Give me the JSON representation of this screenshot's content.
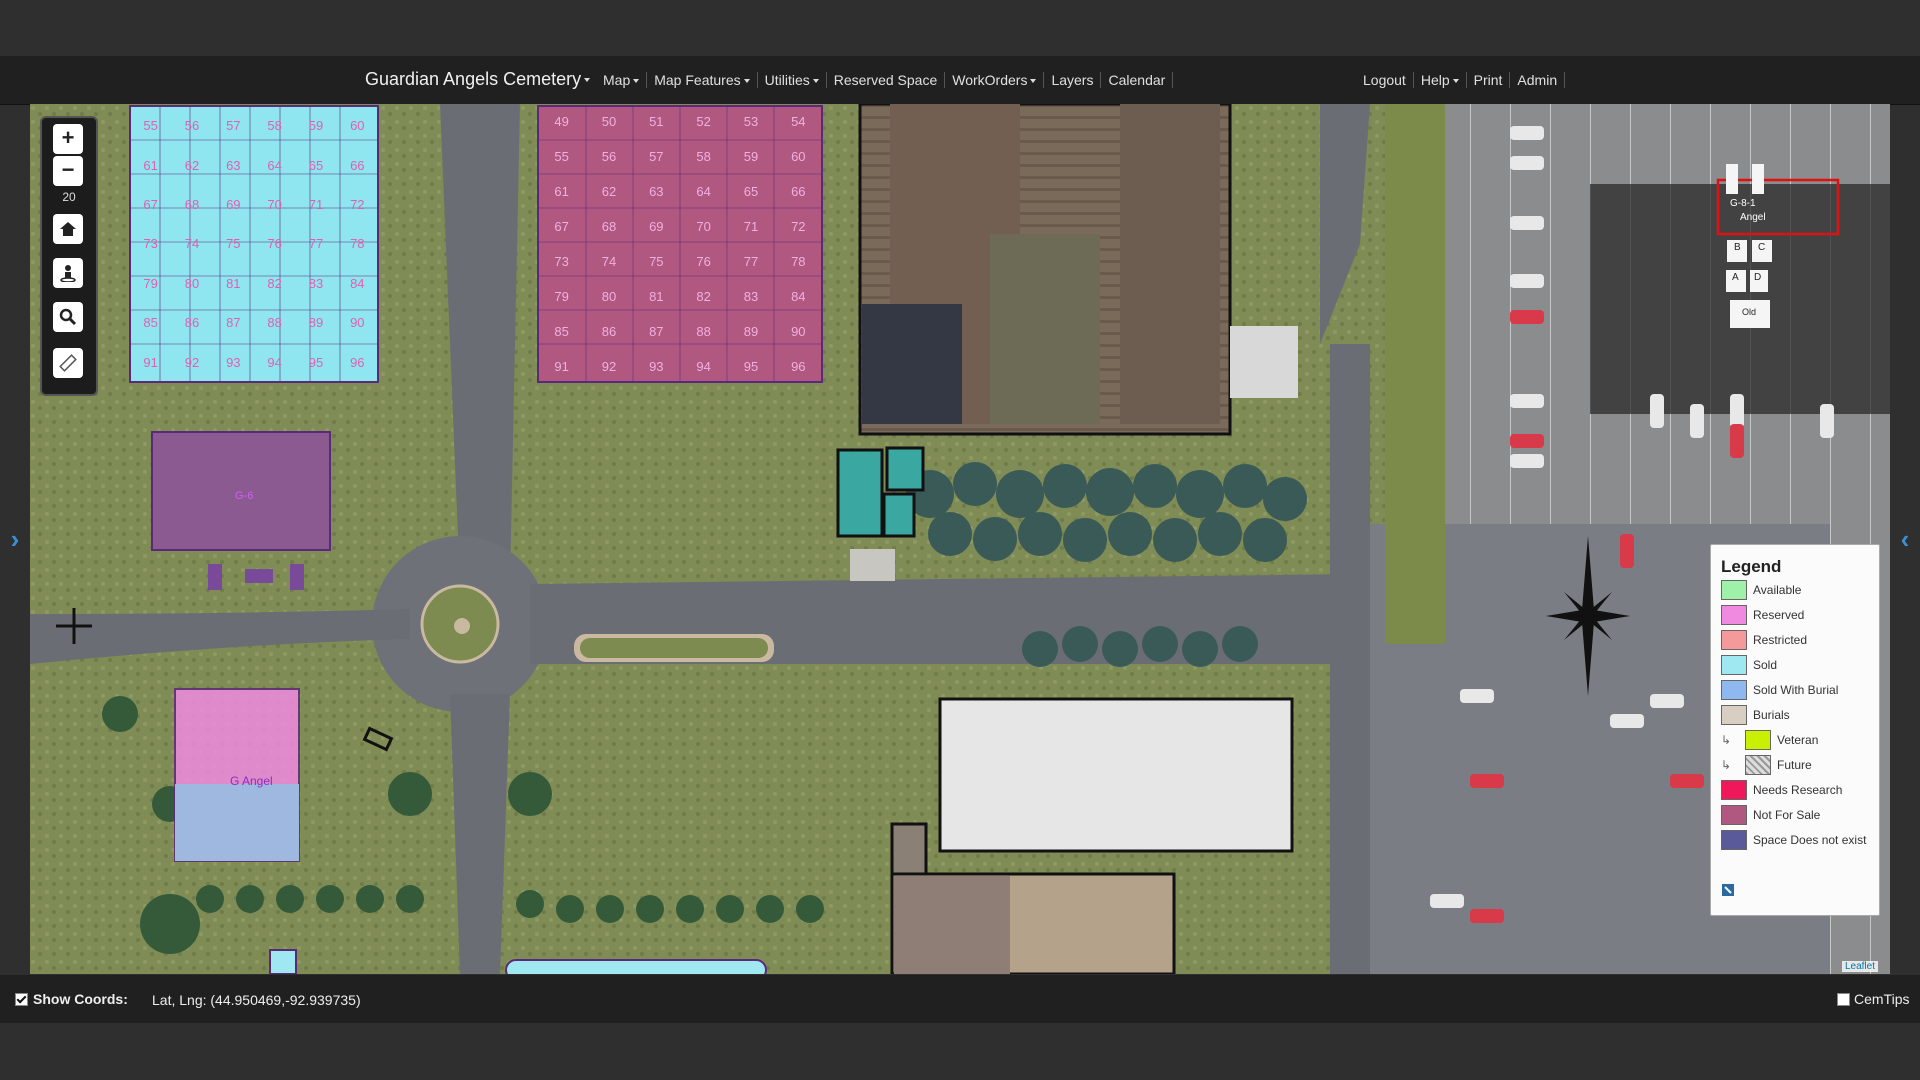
{
  "navbar": {
    "brand": "Guardian Angels Cemetery",
    "left_items": [
      {
        "label": "Map",
        "dropdown": true
      },
      {
        "label": "Map Features",
        "dropdown": true
      },
      {
        "label": "Utilities",
        "dropdown": true
      },
      {
        "label": "Reserved Space",
        "dropdown": false
      },
      {
        "label": "WorkOrders",
        "dropdown": true
      },
      {
        "label": "Layers",
        "dropdown": false
      },
      {
        "label": "Calendar",
        "dropdown": false
      }
    ],
    "right_items": [
      {
        "label": "Logout",
        "dropdown": false
      },
      {
        "label": "Help",
        "dropdown": true
      },
      {
        "label": "Print",
        "dropdown": false
      },
      {
        "label": "Admin",
        "dropdown": false
      }
    ]
  },
  "map": {
    "zoom_in": "+",
    "zoom_out": "−",
    "zoom_level": "20",
    "tools": [
      "home-icon",
      "street-view-icon",
      "zoom-search-icon",
      "ruler-icon"
    ],
    "labels": {
      "section_g6": "G-6",
      "section_g_angel": "G Angel",
      "section_b": "B",
      "section_c": "C",
      "section_a": "A",
      "section_d": "D",
      "section_old": "Old",
      "section_g81": "G-8-1",
      "section_angel": "Angel"
    },
    "plot_numbers_left": [
      "55",
      "56",
      "57",
      "58",
      "59",
      "60",
      "61",
      "62",
      "63",
      "64",
      "65",
      "66",
      "67",
      "68",
      "69",
      "70",
      "71",
      "72",
      "73",
      "74",
      "75",
      "76",
      "77",
      "78",
      "79",
      "80",
      "81",
      "82",
      "83",
      "84",
      "85",
      "86",
      "87",
      "88",
      "89",
      "90",
      "91",
      "92",
      "93",
      "94",
      "95",
      "96"
    ],
    "plot_numbers_right": [
      "49",
      "50",
      "51",
      "52",
      "53",
      "54",
      "55",
      "56",
      "57",
      "58",
      "59",
      "60",
      "61",
      "62",
      "63",
      "64",
      "65",
      "66",
      "67",
      "68",
      "69",
      "70",
      "71",
      "72",
      "73",
      "74",
      "75",
      "76",
      "77",
      "78",
      "79",
      "80",
      "81",
      "82",
      "83",
      "84",
      "85",
      "86",
      "87",
      "88",
      "89",
      "90",
      "91",
      "92",
      "93",
      "94",
      "95",
      "96"
    ],
    "attribution": "Leaflet"
  },
  "legend": {
    "title": "Legend",
    "items": [
      {
        "label": "Available",
        "color": "#9ff0a8",
        "sub": false
      },
      {
        "label": "Reserved",
        "color": "#f08ae0",
        "sub": false
      },
      {
        "label": "Restricted",
        "color": "#f49a9a",
        "sub": false
      },
      {
        "label": "Sold",
        "color": "#9fe8f2",
        "sub": false
      },
      {
        "label": "Sold With Burial",
        "color": "#8fb8f0",
        "sub": false
      },
      {
        "label": "Burials",
        "color": "#d8cfc2",
        "sub": false
      },
      {
        "label": "Veteran",
        "color": "#c8f000",
        "sub": true
      },
      {
        "label": "Future",
        "color": "hatch",
        "sub": true
      },
      {
        "label": "Needs Research",
        "color": "#f0185a",
        "sub": false
      },
      {
        "label": "Not For Sale",
        "color": "#b05880",
        "sub": false
      },
      {
        "label": "Space Does not exist",
        "color": "#5a5a9a",
        "sub": false
      }
    ]
  },
  "footer": {
    "show_coords_label": "Show Coords:",
    "show_coords_checked": true,
    "coords_text": "Lat, Lng: (44.950469,-92.939735)",
    "cemtips_label": "CemTips",
    "cemtips_checked": false
  }
}
